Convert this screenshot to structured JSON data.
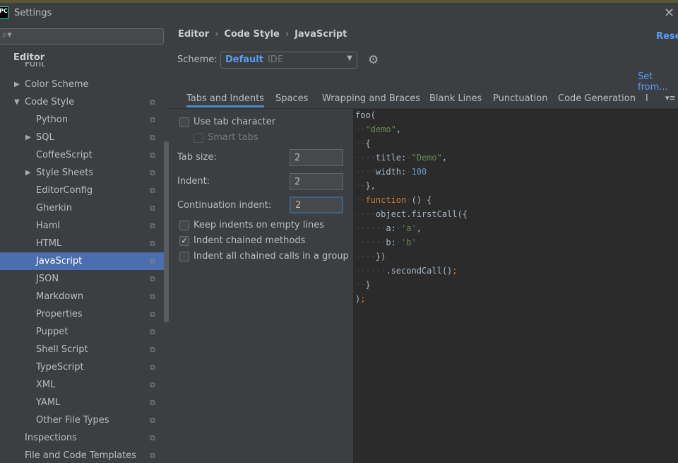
{
  "window": {
    "title": "Settings",
    "logo": "PC"
  },
  "sidebar": {
    "search_placeholder": "",
    "section": "Editor",
    "items": [
      {
        "label": "Font",
        "level": 1,
        "arrow": ""
      },
      {
        "label": "Color Scheme",
        "level": 1,
        "arrow": "right"
      },
      {
        "label": "Code Style",
        "level": 1,
        "arrow": "down",
        "copy": true
      },
      {
        "label": "Python",
        "level": 2,
        "copy": true
      },
      {
        "label": "SQL",
        "level": 2,
        "arrow": "right",
        "copy": true
      },
      {
        "label": "CoffeeScript",
        "level": 2,
        "copy": true
      },
      {
        "label": "Style Sheets",
        "level": 2,
        "arrow": "right",
        "copy": true
      },
      {
        "label": "EditorConfig",
        "level": 2,
        "copy": true
      },
      {
        "label": "Gherkin",
        "level": 2,
        "copy": true
      },
      {
        "label": "Haml",
        "level": 2,
        "copy": true
      },
      {
        "label": "HTML",
        "level": 2,
        "copy": true
      },
      {
        "label": "JavaScript",
        "level": 2,
        "copy": true,
        "selected": true
      },
      {
        "label": "JSON",
        "level": 2,
        "copy": true
      },
      {
        "label": "Markdown",
        "level": 2,
        "copy": true
      },
      {
        "label": "Properties",
        "level": 2,
        "copy": true
      },
      {
        "label": "Puppet",
        "level": 2,
        "copy": true
      },
      {
        "label": "Shell Script",
        "level": 2,
        "copy": true
      },
      {
        "label": "TypeScript",
        "level": 2,
        "copy": true
      },
      {
        "label": "XML",
        "level": 2,
        "copy": true
      },
      {
        "label": "YAML",
        "level": 2,
        "copy": true
      },
      {
        "label": "Other File Types",
        "level": 2,
        "copy": true
      },
      {
        "label": "Inspections",
        "level": 1,
        "copy": true
      },
      {
        "label": "File and Code Templates",
        "level": 1,
        "copy": true
      }
    ]
  },
  "breadcrumb": [
    "Editor",
    "Code Style",
    "JavaScript"
  ],
  "reset_label": "Reset",
  "scheme": {
    "label": "Scheme:",
    "name": "Default",
    "type": "IDE"
  },
  "set_from": "Set from...",
  "tabs": [
    "Tabs and Indents",
    "Spaces",
    "Wrapping and Braces",
    "Blank Lines",
    "Punctuation",
    "Code Generation",
    "I"
  ],
  "options": {
    "use_tab": {
      "label": "Use tab character",
      "checked": false
    },
    "smart_tabs": {
      "label": "Smart tabs",
      "checked": false,
      "disabled": true
    },
    "tab_size": {
      "label": "Tab size:",
      "value": "2"
    },
    "indent": {
      "label": "Indent:",
      "value": "2"
    },
    "cont_indent": {
      "label": "Continuation indent:",
      "value": "2"
    },
    "keep_indents": {
      "label": "Keep indents on empty lines",
      "checked": false
    },
    "chained": {
      "label": "Indent chained methods",
      "checked": true
    },
    "chained_group": {
      "label": "Indent all chained calls in a group",
      "checked": false
    }
  },
  "code": [
    [
      [
        "",
        "foo("
      ]
    ],
    [
      [
        "ws",
        "··"
      ],
      [
        "s",
        "\"demo\""
      ],
      [
        "",
        ","
      ]
    ],
    [
      [
        "ws",
        "··"
      ],
      [
        "",
        "{"
      ]
    ],
    [
      [
        "ws",
        "····"
      ],
      [
        "",
        "title:"
      ],
      [
        "ws",
        "·"
      ],
      [
        "s",
        "\"Demo\""
      ],
      [
        "",
        ","
      ]
    ],
    [
      [
        "ws",
        "····"
      ],
      [
        "",
        "width:"
      ],
      [
        "ws",
        "·"
      ],
      [
        "n",
        "100"
      ]
    ],
    [
      [
        "ws",
        "··"
      ],
      [
        "",
        "},"
      ]
    ],
    [
      [
        "ws",
        "··"
      ],
      [
        "k",
        "function"
      ],
      [
        "ws",
        "·"
      ],
      [
        "",
        "()"
      ],
      [
        "ws",
        "·"
      ],
      [
        "",
        "{"
      ]
    ],
    [
      [
        "ws",
        "····"
      ],
      [
        "",
        "object.firstCall({"
      ]
    ],
    [
      [
        "ws",
        "······"
      ],
      [
        "",
        "a:"
      ],
      [
        "ws",
        "·"
      ],
      [
        "s",
        "'a'"
      ],
      [
        "",
        ","
      ]
    ],
    [
      [
        "ws",
        "······"
      ],
      [
        "",
        "b:"
      ],
      [
        "ws",
        "·"
      ],
      [
        "s",
        "'b'"
      ]
    ],
    [
      [
        "ws",
        "····"
      ],
      [
        "",
        "})"
      ]
    ],
    [
      [
        "ws",
        "······"
      ],
      [
        "",
        ".secondCall()"
      ],
      [
        "k",
        ";"
      ]
    ],
    [
      [
        "ws",
        "··"
      ],
      [
        "",
        "}"
      ]
    ],
    [
      [
        "",
        ")"
      ],
      [
        "k",
        ";"
      ]
    ]
  ]
}
